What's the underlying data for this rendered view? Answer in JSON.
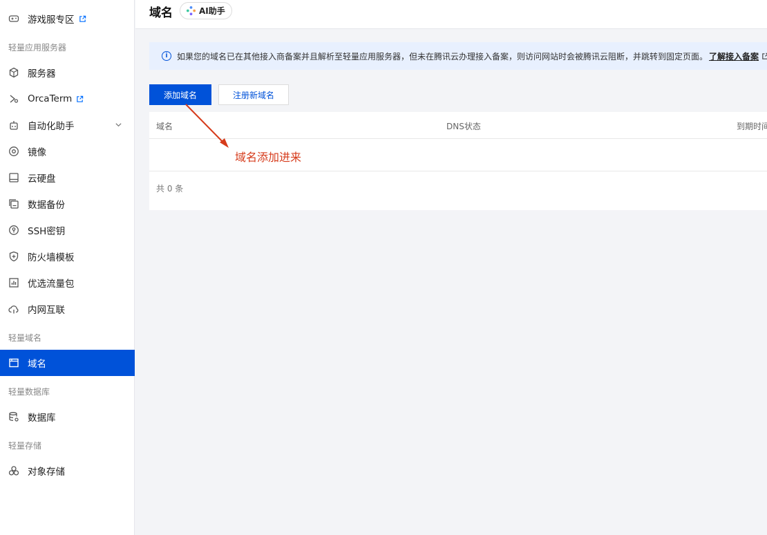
{
  "sidebar": {
    "items": [
      {
        "label": "游戏服专区",
        "icon": "gamepad-icon",
        "external": true
      },
      {
        "label": "服务器",
        "icon": "cube-icon"
      },
      {
        "label": "OrcaTerm",
        "icon": "terminal-icon",
        "external": true
      },
      {
        "label": "自动化助手",
        "icon": "robot-icon",
        "expandable": true
      },
      {
        "label": "镜像",
        "icon": "disc-icon"
      },
      {
        "label": "云硬盘",
        "icon": "disk-icon"
      },
      {
        "label": "数据备份",
        "icon": "backup-icon"
      },
      {
        "label": "SSH密钥",
        "icon": "key-icon"
      },
      {
        "label": "防火墙模板",
        "icon": "shield-icon"
      },
      {
        "label": "优选流量包",
        "icon": "chart-icon"
      },
      {
        "label": "内网互联",
        "icon": "cloud-link-icon"
      },
      {
        "label": "域名",
        "icon": "window-icon",
        "active": true
      },
      {
        "label": "数据库",
        "icon": "database-icon"
      },
      {
        "label": "对象存储",
        "icon": "objects-icon"
      }
    ],
    "groups": [
      "轻量应用服务器",
      "轻量域名",
      "轻量数据库",
      "轻量存储"
    ]
  },
  "header": {
    "title": "域名",
    "ai_label": "AI助手"
  },
  "notice": {
    "text": "如果您的域名已在其他接入商备案并且解析至轻量应用服务器，但未在腾讯云办理接入备案，则访问网站时会被腾讯云阻断，并跳转到固定页面。",
    "link": "了解接入备案"
  },
  "toolbar": {
    "add_label": "添加域名",
    "register_label": "注册新域名"
  },
  "table": {
    "columns": [
      "域名",
      "DNS状态",
      "到期时间"
    ],
    "footer": "共 0 条"
  },
  "annotation": {
    "text": "域名添加进来",
    "color": "#d63b1b"
  },
  "colors": {
    "accent": "#0052d9",
    "notice_bg": "#e8f0fe"
  }
}
